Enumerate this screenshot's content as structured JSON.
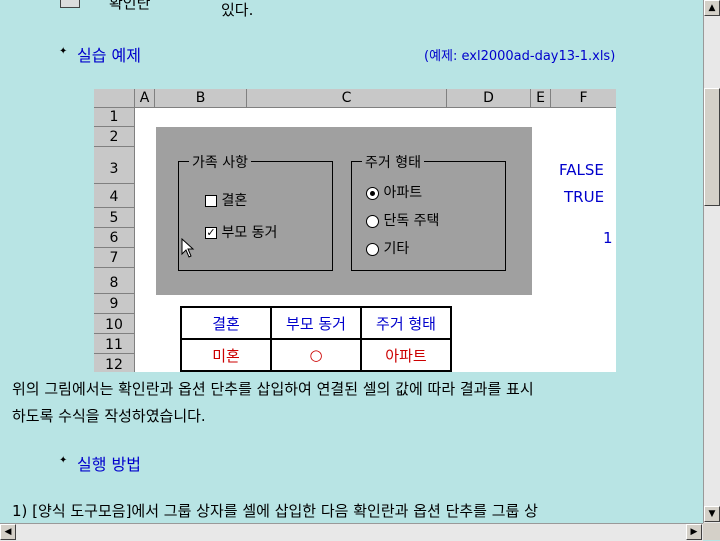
{
  "top": {
    "checkbox_label": "확인란",
    "trailing_text": "있다."
  },
  "section1": {
    "title": "실습 예제",
    "example_file": "(예제: exl2000ad-day13-1.xls)"
  },
  "sheet": {
    "columns": [
      "A",
      "B",
      "C",
      "D",
      "E",
      "F"
    ],
    "rows": [
      "1",
      "2",
      "3",
      "4",
      "5",
      "6",
      "7",
      "8",
      "9",
      "10",
      "11",
      "12"
    ],
    "family_group": {
      "title": "가족 사항",
      "options": [
        {
          "label": "결혼",
          "checked": false
        },
        {
          "label": "부모 동거",
          "checked": true
        }
      ]
    },
    "housing_group": {
      "title": "주거 형태",
      "options": [
        {
          "label": "아파트",
          "selected": true
        },
        {
          "label": "단독 주택",
          "selected": false
        },
        {
          "label": "기타",
          "selected": false
        }
      ]
    },
    "linked_cells": {
      "f3": "FALSE",
      "f4": "TRUE",
      "f6": "1"
    },
    "result_table": {
      "headers": [
        "결혼",
        "부모 동거",
        "주거 형태"
      ],
      "values": [
        "미혼",
        "○",
        "아파트"
      ]
    }
  },
  "paragraph": "위의 그림에서는 확인란과 옵션 단추를 삽입하여 연결된 셀의 값에 따라 결과를 표시하도록 수식을 작성하였습니다.",
  "paragraph_line1": "위의 그림에서는 확인란과 옵션 단추를 삽입하여 연결된 셀의 값에 따라 결과를 표시",
  "paragraph_line2": "하도록 수식을 작성하였습니다.",
  "section2": {
    "title": "실행 방법"
  },
  "step1": "1) [양식 도구모음]에서 그룹 상자를 셀에 삽입한 다음 확인란과 옵션 단추를 그룹 상",
  "colors": {
    "background": "#b8e4e4",
    "heading": "#0000cc",
    "result_value": "#cc0000",
    "linked_value": "#0000cc",
    "group_panel": "#a0a0a0"
  }
}
